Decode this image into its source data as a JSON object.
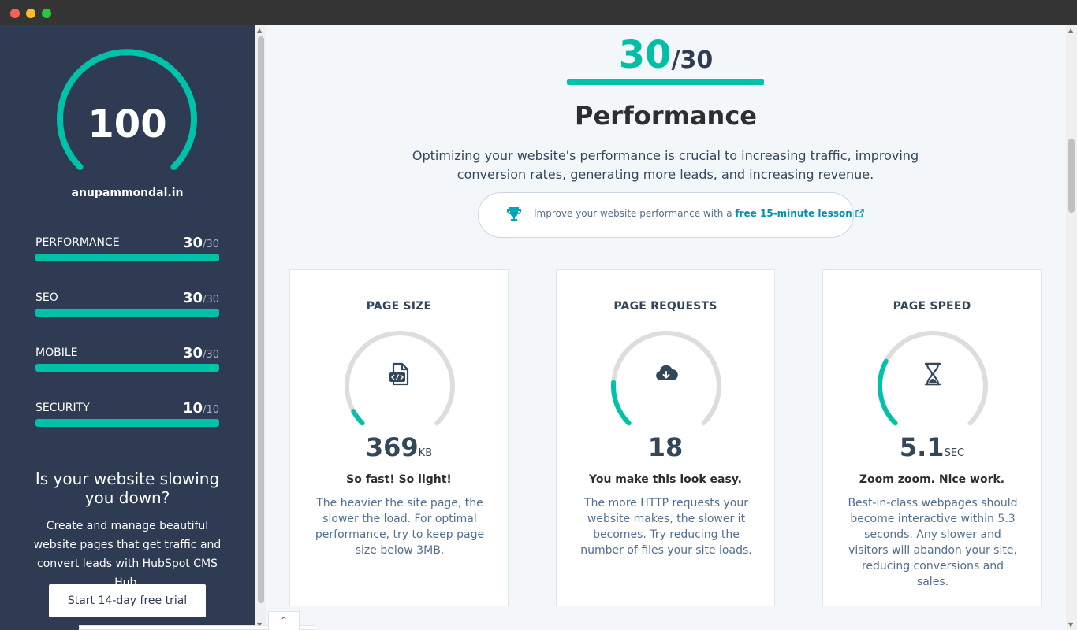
{
  "window": {
    "title": ""
  },
  "sidebar": {
    "overall_score": "100",
    "domain": "anupammondal.in",
    "categories": [
      {
        "label": "PERFORMANCE",
        "score": "30",
        "max": "/30",
        "fraction": 1.0
      },
      {
        "label": "SEO",
        "score": "30",
        "max": "/30",
        "fraction": 1.0
      },
      {
        "label": "MOBILE",
        "score": "30",
        "max": "/30",
        "fraction": 1.0
      },
      {
        "label": "SECURITY",
        "score": "10",
        "max": "/10",
        "fraction": 1.0
      }
    ],
    "promo_title": "Is your website slowing you down?",
    "promo_text": "Create and manage beautiful website pages that get traffic and convert leads with HubSpot CMS Hub.",
    "cta_label": "Start 14-day free trial"
  },
  "main": {
    "section_score": "30",
    "section_max": "/30",
    "section_title": "Performance",
    "section_desc": "Optimizing your website's performance is crucial to increasing traffic, improving conversion rates, generating more leads, and increasing revenue.",
    "lesson_text": "Improve your website performance with a",
    "lesson_link": "free 15-minute lesson",
    "cards": [
      {
        "title": "PAGE SIZE",
        "value": "369",
        "unit": "KB",
        "subtitle": "So fast! So light!",
        "desc": "The heavier the site page, the slower the load. For optimal performance, try to keep page size below 3MB.",
        "icon": "file-code-icon",
        "gauge_fraction": 0.06
      },
      {
        "title": "PAGE REQUESTS",
        "value": "18",
        "unit": "",
        "subtitle": "You make this look easy.",
        "desc": "The more HTTP requests your website makes, the slower it becomes. Try reducing the number of files your site loads.",
        "icon": "cloud-download-icon",
        "gauge_fraction": 0.18
      },
      {
        "title": "PAGE SPEED",
        "value": "5.1",
        "unit": "SEC",
        "subtitle": "Zoom zoom. Nice work.",
        "desc": "Best-in-class webpages should become interactive within 5.3 seconds. Any slower and visitors will abandon your site, reducing conversions and sales.",
        "icon": "hourglass-icon",
        "gauge_fraction": 0.27
      }
    ]
  },
  "colors": {
    "accent": "#00c2a8",
    "sidebar_bg": "#2e3b52",
    "gauge_track": "#dddddd",
    "link": "#0091ae"
  }
}
